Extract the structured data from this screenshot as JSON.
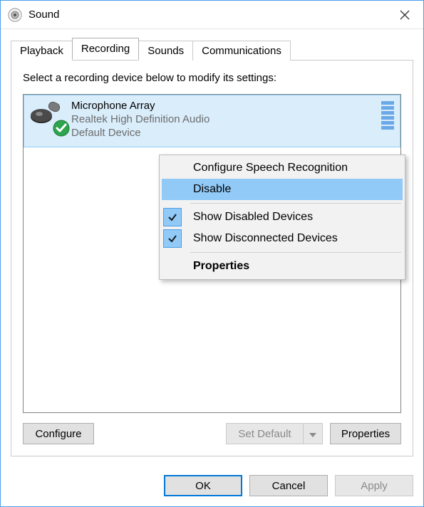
{
  "window": {
    "title": "Sound"
  },
  "tabs": {
    "playback": "Playback",
    "recording": "Recording",
    "sounds": "Sounds",
    "communications": "Communications",
    "active": "recording"
  },
  "instruction": "Select a recording device below to modify its settings:",
  "device": {
    "name": "Microphone Array",
    "description": "Realtek High Definition Audio",
    "status": "Default Device"
  },
  "buttons": {
    "configure": "Configure",
    "set_default": "Set Default",
    "properties": "Properties",
    "ok": "OK",
    "cancel": "Cancel",
    "apply": "Apply"
  },
  "context_menu": {
    "configure_speech": "Configure Speech Recognition",
    "disable": "Disable",
    "show_disabled": "Show Disabled Devices",
    "show_disconnected": "Show Disconnected Devices",
    "properties": "Properties",
    "highlighted": "disable",
    "checked": [
      "show_disabled",
      "show_disconnected"
    ]
  }
}
